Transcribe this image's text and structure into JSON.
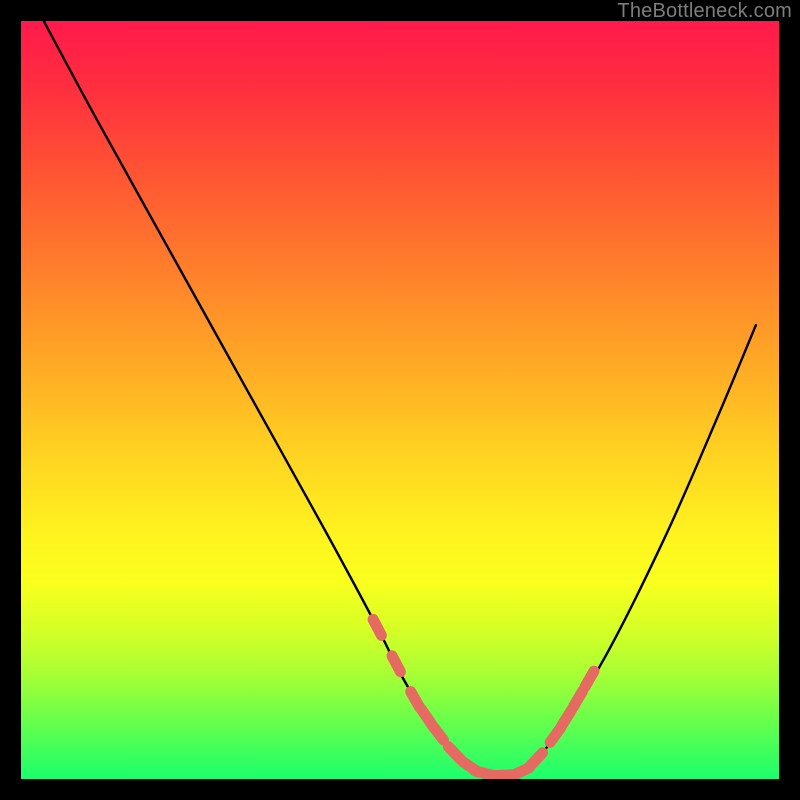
{
  "watermark": "TheBottleneck.com",
  "colors": {
    "background": "#000000",
    "gradient_top": "#ff1a4b",
    "gradient_mid1": "#ff7c2c",
    "gradient_mid2": "#fff41f",
    "gradient_bottom": "#1bff6c",
    "curve": "#000000",
    "marker": "#e56a62"
  },
  "chart_data": {
    "type": "line",
    "title": "",
    "xlabel": "",
    "ylabel": "",
    "xlim": [
      0,
      100
    ],
    "ylim": [
      0,
      100
    ],
    "grid": false,
    "legend": false,
    "series": [
      {
        "name": "bottleneck-curve",
        "x": [
          3,
          10,
          20,
          30,
          40,
          47,
          50,
          53,
          56.5,
          60,
          63,
          66,
          70,
          77,
          85,
          92,
          97
        ],
        "values": [
          100,
          87,
          69,
          51,
          33,
          20,
          14,
          9,
          4,
          1,
          0.5,
          1,
          5,
          16,
          32,
          48,
          60
        ]
      }
    ],
    "markers": {
      "name": "highlight-points",
      "color": "#e56a62",
      "x": [
        47,
        49.5,
        52,
        53.5,
        55,
        57.2,
        59.3,
        61,
        63.5,
        66,
        68,
        70.5,
        72,
        73.5,
        75
      ],
      "values": [
        20,
        15.2,
        10.5,
        8.2,
        6.1,
        3.4,
        1.6,
        0.8,
        0.5,
        1,
        2.6,
        5.8,
        8.1,
        10.6,
        13.2
      ]
    },
    "annotations": []
  }
}
